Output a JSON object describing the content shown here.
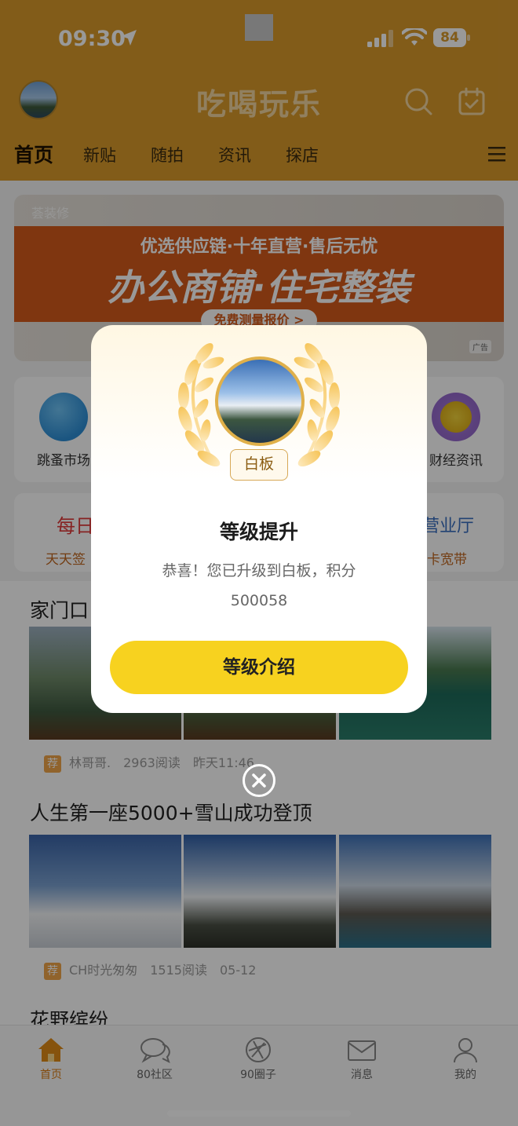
{
  "status_bar": {
    "time": "09:30",
    "battery": "84"
  },
  "header": {
    "app_title": "吃喝玩乐",
    "nav": [
      "首页",
      "新贴",
      "随拍",
      "资讯",
      "探店"
    ]
  },
  "banner": {
    "brand": "荟装修",
    "line1": "优选供应链·十年直营·售后无忧",
    "line2": "办公商铺·住宅整装",
    "cta": "免费测量报价 >",
    "ad_tag": "广告"
  },
  "quick_entries": [
    {
      "label": "跳蚤市场",
      "icon": "flea-market-icon"
    },
    {
      "label": "财经资讯",
      "icon": "finance-coin-icon"
    }
  ],
  "promo": {
    "left_title": "每日",
    "left_sub": "天天签",
    "right_title": "营业厅",
    "right_sub": "卡宽带"
  },
  "posts": [
    {
      "title": "家门口",
      "tag": "荐",
      "author": "林哥哥.",
      "reads": "2963阅读",
      "time": "昨天11:46"
    },
    {
      "title": "人生第一座5000+雪山成功登顶",
      "tag": "荐",
      "author": "CH时光匆匆",
      "reads": "1515阅读",
      "time": "05-12"
    },
    {
      "title": "花野缤纷"
    }
  ],
  "tabbar": [
    {
      "label": "首页",
      "icon": "home-icon"
    },
    {
      "label": "80社区",
      "icon": "chat-bubble-icon"
    },
    {
      "label": "90圈子",
      "icon": "aperture-icon"
    },
    {
      "label": "消息",
      "icon": "mail-icon"
    },
    {
      "label": "我的",
      "icon": "person-icon"
    }
  ],
  "modal": {
    "level_name": "白板",
    "title": "等级提升",
    "message_line1": "恭喜！您已升级到白板，积分",
    "message_line2": "500058",
    "button": "等级介绍"
  },
  "colors": {
    "header_bg": "#d99a2b",
    "accent_orange": "#d97a12",
    "button_yellow": "#f7d21f",
    "laurel_gold": "#f0c56a"
  }
}
